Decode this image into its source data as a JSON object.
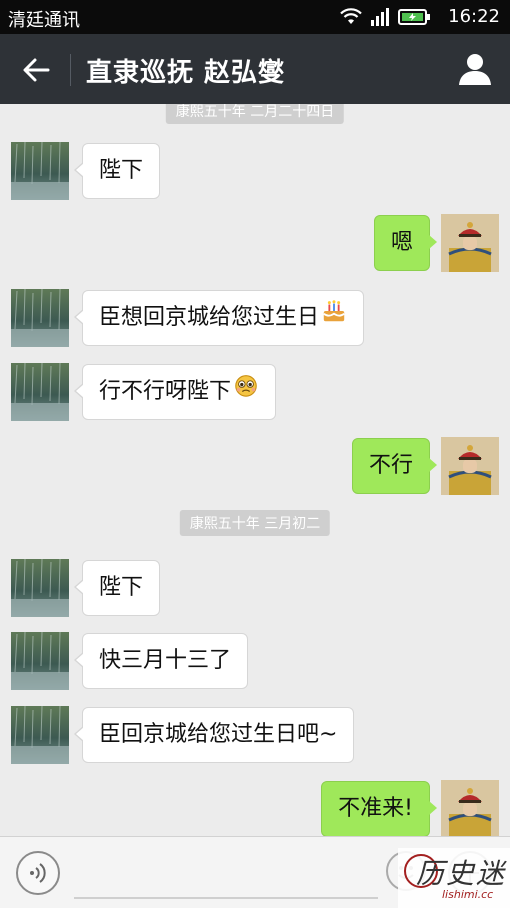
{
  "status_bar": {
    "carrier": "清廷通讯",
    "time": "16:22"
  },
  "header": {
    "title": "直隶巡抚 赵弘燮"
  },
  "messages": [
    {
      "kind": "timestamp",
      "text": "康熙五十年 二月二十四日"
    },
    {
      "kind": "msg",
      "side": "left",
      "text": "陛下"
    },
    {
      "kind": "msg",
      "side": "right",
      "text": "嗯"
    },
    {
      "kind": "msg",
      "side": "left",
      "text": "臣想回京城给您过生日",
      "emoji": "cake-emoji"
    },
    {
      "kind": "msg",
      "side": "left",
      "text": "行不行呀陛下",
      "emoji": "pleading-emoji"
    },
    {
      "kind": "msg",
      "side": "right",
      "text": "不行"
    },
    {
      "kind": "timestamp",
      "text": "康熙五十年 三月初二"
    },
    {
      "kind": "msg",
      "side": "left",
      "text": "陛下"
    },
    {
      "kind": "msg",
      "side": "left",
      "text": "快三月十三了"
    },
    {
      "kind": "msg",
      "side": "left",
      "text": "臣回京城给您过生日吧~"
    },
    {
      "kind": "msg",
      "side": "right",
      "text": "不准来!"
    }
  ],
  "input": {
    "placeholder": ""
  },
  "watermark": {
    "text": "历史迷",
    "sub": "lishimi.cc"
  },
  "colors": {
    "header_bg": "#2e3237",
    "sent_bubble": "#9fe85a",
    "chat_bg": "#ececec"
  },
  "icons": [
    "back-arrow-icon",
    "profile-icon",
    "wifi-icon",
    "signal-icon",
    "battery-icon",
    "voice-icon",
    "emoji-icon",
    "plus-icon"
  ]
}
